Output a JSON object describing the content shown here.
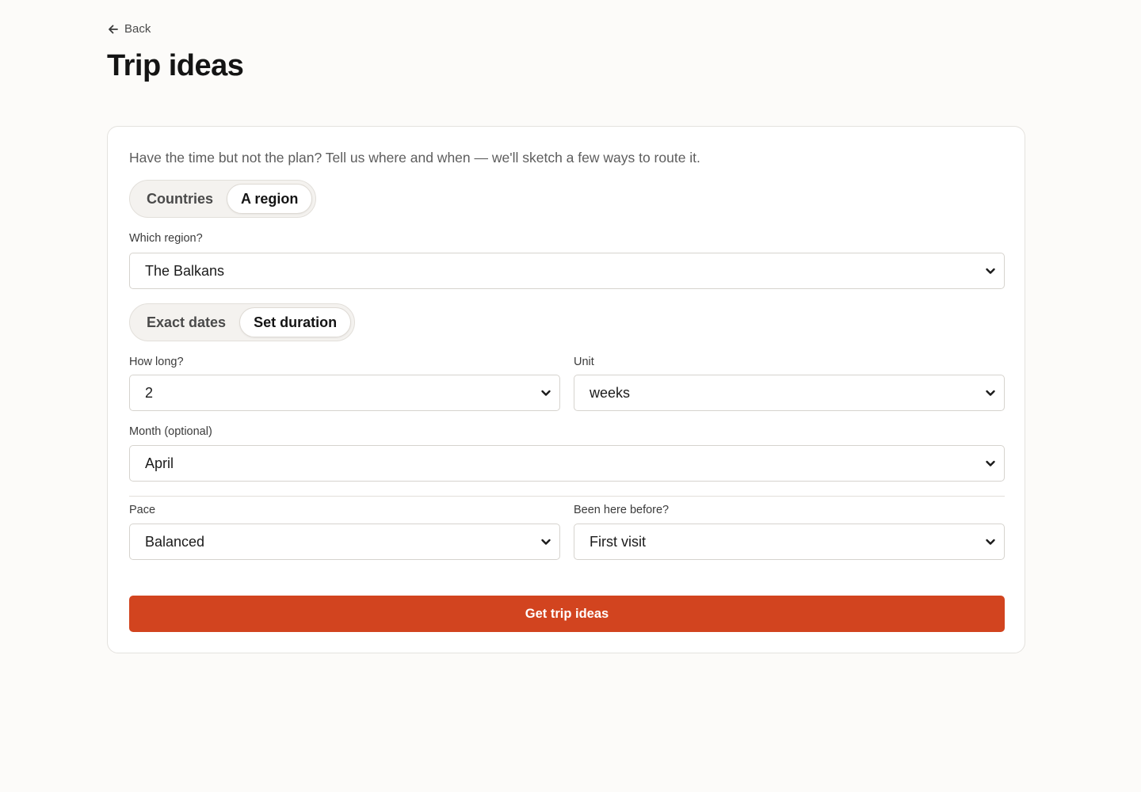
{
  "nav": {
    "back_label": "Back"
  },
  "page": {
    "title": "Trip ideas"
  },
  "form": {
    "intro": "Have the time but not the plan? Tell us where and when — we'll sketch a few ways to route it.",
    "scope_toggle": {
      "options": [
        "Countries",
        "A region"
      ],
      "selected": "A region"
    },
    "region": {
      "label": "Which region?",
      "value": "The Balkans"
    },
    "time_toggle": {
      "options": [
        "Exact dates",
        "Set duration"
      ],
      "selected": "Set duration"
    },
    "how_long": {
      "label": "How long?",
      "value": "2"
    },
    "unit": {
      "label": "Unit",
      "value": "weeks"
    },
    "month": {
      "label": "Month (optional)",
      "value": "April"
    },
    "pace": {
      "label": "Pace",
      "value": "Balanced"
    },
    "been_before": {
      "label": "Been here before?",
      "value": "First visit"
    },
    "submit_label": "Get trip ideas"
  },
  "colors": {
    "accent": "#d2441f",
    "background": "#fcfbf9",
    "card": "#ffffff"
  },
  "icons": {
    "back": "arrow-left-icon",
    "dropdown": "chevron-down-icon"
  }
}
